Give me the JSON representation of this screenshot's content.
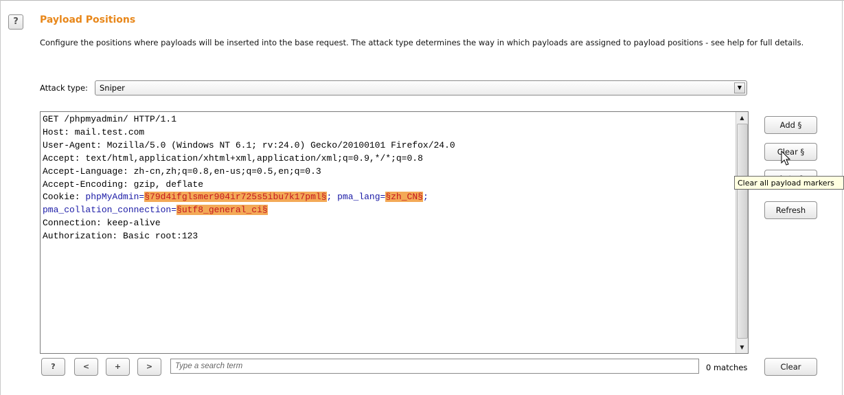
{
  "section": {
    "title": "Payload Positions",
    "help_icon": "?",
    "description": "Configure the positions where payloads will be inserted into the base request. The attack type determines the way in which payloads are assigned to payload positions - see help for full details."
  },
  "attack_type": {
    "label": "Attack type:",
    "selected": "Sniper",
    "arrow": "▼"
  },
  "request": {
    "lines": [
      [
        {
          "t": "GET /phpmyadmin/ HTTP/1.1"
        }
      ],
      [
        {
          "t": "Host: mail.test.com"
        }
      ],
      [
        {
          "t": "User-Agent: Mozilla/5.0 (Windows NT 6.1; rv:24.0) Gecko/20100101 Firefox/24.0"
        }
      ],
      [
        {
          "t": "Accept: text/html,application/xhtml+xml,application/xml;q=0.9,*/*;q=0.8"
        }
      ],
      [
        {
          "t": "Accept-Language: zh-cn,zh;q=0.8,en-us;q=0.5,en;q=0.3"
        }
      ],
      [
        {
          "t": "Accept-Encoding: gzip, deflate"
        }
      ],
      [
        {
          "t": "Cookie: "
        },
        {
          "t": "phpMyAdmin=",
          "c": "blue"
        },
        {
          "t": "§79d4ifglsmer904ir725s5ibu7k17pml§",
          "c": "hl"
        },
        {
          "t": "; ",
          "c": "blue"
        },
        {
          "t": "pma_lang=",
          "c": "blue"
        },
        {
          "t": "§zh_CN§",
          "c": "hl"
        },
        {
          "t": ";",
          "c": "blue"
        }
      ],
      [
        {
          "t": "pma_collation_connection=",
          "c": "blue"
        },
        {
          "t": "§utf8_general_ci§",
          "c": "hl"
        }
      ],
      [
        {
          "t": "Connection: keep-alive"
        }
      ],
      [
        {
          "t": "Authorization: Basic root:123"
        }
      ]
    ]
  },
  "buttons": {
    "add": "Add §",
    "clear_marker": "Clear §",
    "auto": "Auto §",
    "refresh": "Refresh",
    "clear": "Clear"
  },
  "tooltip": "Clear all payload markers",
  "search": {
    "help": "?",
    "prev": "<",
    "add": "+",
    "next": ">",
    "placeholder": "Type a search term",
    "matches": "0 matches"
  },
  "scrollbar": {
    "up": "▲",
    "down": "▼"
  },
  "colors": {
    "title": "#e8871a",
    "marker_bg": "#f3a957",
    "marker_text": "#c4171e",
    "param": "#1a1aa6"
  }
}
